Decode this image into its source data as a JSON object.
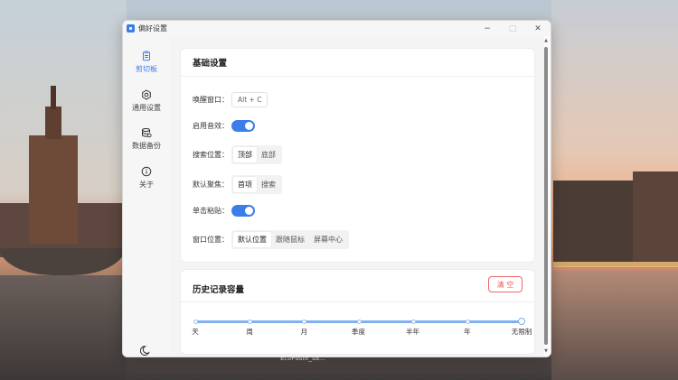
{
  "desktop": {
    "taskbar_label": "EcoPaste_sa..."
  },
  "window": {
    "title": "偏好设置",
    "controls": {
      "minimize": "−",
      "maximize": "□",
      "close": "✕"
    }
  },
  "sidebar": {
    "items": [
      {
        "label": "剪切板",
        "icon": "clipboard-icon",
        "active": true
      },
      {
        "label": "通用设置",
        "icon": "settings-icon",
        "active": false
      },
      {
        "label": "数据备份",
        "icon": "backup-icon",
        "active": false
      },
      {
        "label": "关于",
        "icon": "info-icon",
        "active": false
      }
    ],
    "theme_icon": "moon-icon"
  },
  "basic_settings": {
    "title": "基础设置",
    "wake_window": {
      "label": "唤醒窗口：",
      "value": "Alt + C"
    },
    "sound": {
      "label": "启用音效：",
      "enabled": true
    },
    "search_position": {
      "label": "搜索位置：",
      "options": [
        "顶部",
        "底部"
      ],
      "selected": "顶部"
    },
    "default_focus": {
      "label": "默认聚焦：",
      "options": [
        "首项",
        "搜索"
      ],
      "selected": "首项"
    },
    "click_paste": {
      "label": "单击粘贴：",
      "enabled": true
    },
    "window_position": {
      "label": "窗口位置：",
      "options": [
        "默认位置",
        "跟随鼠标",
        "屏幕中心"
      ],
      "selected": "默认位置"
    }
  },
  "history": {
    "title": "历史记录容量",
    "clear_label": "清 空",
    "marks": [
      "天",
      "周",
      "月",
      "季度",
      "半年",
      "年",
      "无限制"
    ],
    "selected_index": 6
  },
  "colors": {
    "accent": "#3b7de9",
    "danger": "#ee5555"
  }
}
